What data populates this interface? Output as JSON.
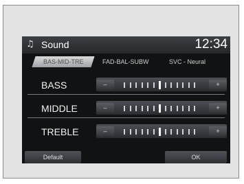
{
  "header": {
    "title": "Sound",
    "time": "12:34",
    "icon": "music-note-icon"
  },
  "tabs": [
    {
      "label": "BAS-MID-TRE",
      "active": true
    },
    {
      "label": "FAD-BAL-SUBW",
      "active": false
    },
    {
      "label": "SVC - Neural",
      "active": false
    }
  ],
  "controls": [
    {
      "label": "BASS",
      "minus": "–",
      "plus": "+"
    },
    {
      "label": "MIDDLE",
      "minus": "–",
      "plus": "+"
    },
    {
      "label": "TREBLE",
      "minus": "–",
      "plus": "+"
    }
  ],
  "footer": {
    "default_label": "Default",
    "ok_label": "OK"
  }
}
